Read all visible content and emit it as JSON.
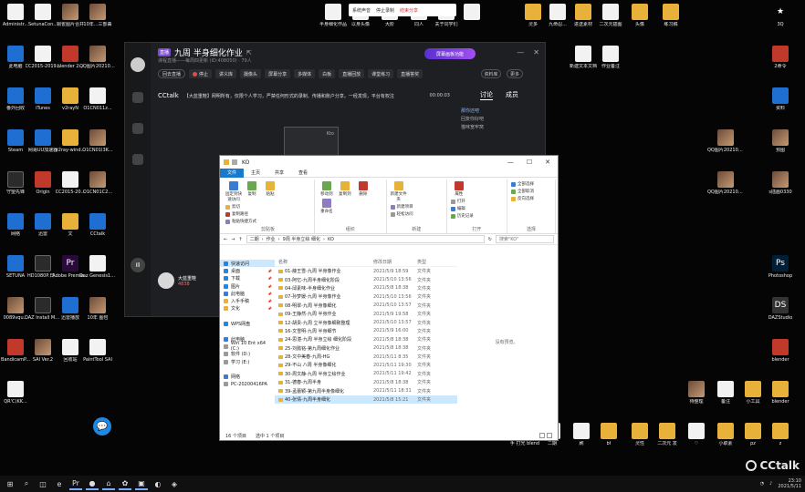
{
  "desktop": {
    "icons_left": [
      {
        "label": "Administr...",
        "kind": "file"
      },
      {
        "label": "SetunaCon...",
        "kind": "file"
      },
      {
        "label": "铜雀图片合并",
        "kind": "img"
      },
      {
        "label": "10年...三部曲",
        "kind": "img"
      },
      {
        "label": "此电脑",
        "kind": "blue"
      },
      {
        "label": "CC2015-2019...",
        "kind": "file"
      },
      {
        "label": "blender 2...",
        "kind": "red"
      },
      {
        "label": "QQ图片20210511...",
        "kind": "img"
      },
      {
        "label": "番外回收",
        "kind": "blue"
      },
      {
        "label": "iTunes",
        "kind": "blue"
      },
      {
        "label": "v2rayN",
        "kind": "folder"
      },
      {
        "label": "O1CN011z...",
        "kind": "file"
      },
      {
        "label": "Steam",
        "kind": "blue"
      },
      {
        "label": "网易UU加速器",
        "kind": "blue"
      },
      {
        "label": "v2ray-wind...",
        "kind": "folder"
      },
      {
        "label": "O1CN01I3K...",
        "kind": "img"
      },
      {
        "label": "守望先锋",
        "kind": "dark"
      },
      {
        "label": "Origin",
        "kind": "red"
      },
      {
        "label": "CC2015-20...",
        "kind": "file"
      },
      {
        "label": "O1CN01C2...",
        "kind": "img"
      },
      {
        "label": "网络",
        "kind": "blue"
      },
      {
        "label": "迅雷",
        "kind": "blue"
      },
      {
        "label": "文",
        "kind": "folder"
      },
      {
        "label": "CCtalk",
        "kind": "blue"
      },
      {
        "label": "SETUNA",
        "kind": "blue"
      },
      {
        "label": "HD1080P.日...",
        "kind": "dark"
      },
      {
        "label": "Adobe Premie...",
        "kind": "pr"
      },
      {
        "label": "Daz Genesis1.2...",
        "kind": "file"
      },
      {
        "label": "0089vqu...",
        "kind": "img"
      },
      {
        "label": "DAZ Install Manager...",
        "kind": "dark"
      },
      {
        "label": "迅雷播放",
        "kind": "blue"
      },
      {
        "label": "10年 图包",
        "kind": "img"
      },
      {
        "label": "BandicamP...",
        "kind": "red"
      },
      {
        "label": "SAI Ver.2",
        "kind": "img"
      },
      {
        "label": "回收站",
        "kind": "file"
      },
      {
        "label": "PaintTool SAI",
        "kind": "file"
      },
      {
        "label": "QR'C)KK...",
        "kind": "file"
      }
    ],
    "icons_top": [
      {
        "label": "半身细化作品",
        "kind": "file"
      },
      {
        "label": "以身头像",
        "kind": "file"
      },
      {
        "label": "大阶",
        "kind": "file"
      },
      {
        "label": "同人",
        "kind": "file"
      },
      {
        "label": "关于同学们",
        "kind": "file"
      },
      {
        "label": "",
        "kind": "file"
      },
      {
        "label": "灵多",
        "kind": "folder"
      },
      {
        "label": "九命忍...",
        "kind": "file"
      },
      {
        "label": "进送素材",
        "kind": "folder"
      },
      {
        "label": "二次元插图",
        "kind": "file"
      },
      {
        "label": "头像",
        "kind": "folder"
      },
      {
        "label": "练习稿",
        "kind": "folder"
      }
    ],
    "icons_right": [
      {
        "label": "3Q",
        "kind": "star"
      },
      {
        "label": "2命令",
        "kind": "red"
      },
      {
        "label": "资料",
        "kind": "blue"
      },
      {
        "label": "QQ图片20210414...",
        "kind": "img"
      },
      {
        "label": "预图",
        "kind": "img"
      },
      {
        "label": "QQ图片20210414...",
        "kind": "img"
      },
      {
        "label": "s插画0330",
        "kind": "img"
      },
      {
        "label": "Photoshop",
        "kind": "ps"
      },
      {
        "label": "DAZStudio",
        "kind": "ds"
      },
      {
        "label": "blender",
        "kind": "red"
      },
      {
        "label": "新建文本文档",
        "kind": "file"
      },
      {
        "label": "作业备注",
        "kind": "file"
      }
    ],
    "icons_bottom": [
      {
        "label": "待整理",
        "kind": "img"
      },
      {
        "label": "备注",
        "kind": "file"
      },
      {
        "label": "小工具",
        "kind": "folder"
      },
      {
        "label": "blender",
        "kind": "folder"
      },
      {
        "label": "手 打光 blend",
        "kind": "file"
      },
      {
        "label": "二期",
        "kind": "file"
      },
      {
        "label": "刷",
        "kind": "file"
      },
      {
        "label": "bf",
        "kind": "folder"
      },
      {
        "label": "灵性",
        "kind": "folder"
      },
      {
        "label": "二次元 发",
        "kind": "folder"
      },
      {
        "label": "♡",
        "kind": "file"
      },
      {
        "label": "小职素",
        "kind": "folder"
      },
      {
        "label": "pz",
        "kind": "folder"
      },
      {
        "label": "z",
        "kind": "folder"
      }
    ]
  },
  "recording_bar": {
    "mute": "系统声音",
    "stop": "停止录制",
    "share": "结束分享"
  },
  "cctalk": {
    "tag": "直播",
    "title": "九周 半身细化作业",
    "subtitle": "课程直播——每周四更新 (ID:408050) · 79人",
    "promo": "屏幕画板功能",
    "btn_more": "资料库",
    "btn_more2": "更多",
    "tools": [
      "回去直播",
      "停止",
      "讲义库",
      "摄像头",
      "屏幕分享",
      "多媒体",
      "白板",
      "直播回放",
      "课堂练习",
      "直播答奖"
    ],
    "ticker_logo": "CCtalk",
    "ticker_text": "【大蓝重鞋】网明所有，仅限个人学习，严禁任何形式的录制、传播和账户分享。一经发现，平台有权注",
    "timer": "00:00:03",
    "whiteboard_label": "Kto",
    "right_tabs": [
      "讨论",
      "成员"
    ],
    "messages": [
      {
        "user": "那你还吧",
        "text": ""
      },
      {
        "user": "",
        "text": "回复你好吧"
      },
      {
        "user": "",
        "text": "猫咪宽牢窝"
      }
    ],
    "teacher_name": "大蓝重鞋",
    "teacher_meta": "4838",
    "side_btn": "Ill"
  },
  "explorer": {
    "title": "KO",
    "ribbon_tabs": [
      "文件",
      "主页",
      "共享",
      "查看"
    ],
    "groups": [
      {
        "name": "剪贴板",
        "large": [
          "固定到快速访问",
          "复制",
          "粘贴"
        ],
        "small": [
          "剪切",
          "复制路径",
          "粘贴快捷方式"
        ]
      },
      {
        "name": "组织",
        "large": [
          "移动到",
          "复制到",
          "删除",
          "重命名"
        ],
        "small": []
      },
      {
        "name": "新建",
        "large": [
          "新建文件夹"
        ],
        "small": [
          "新建项目",
          "轻松访问"
        ]
      },
      {
        "name": "打开",
        "large": [
          "属性"
        ],
        "small": [
          "打开",
          "编辑",
          "历史记录"
        ]
      },
      {
        "name": "选择",
        "large": [],
        "small": [
          "全部选择",
          "全部取消",
          "反向选择"
        ]
      }
    ],
    "path": [
      "二期",
      "作业",
      "9周 半身立绘 细化",
      "KO"
    ],
    "search_placeholder": "搜索\"KO\"",
    "nav": [
      {
        "label": "快速访问",
        "sel": true,
        "pin": false,
        "color": "#1e88e5"
      },
      {
        "label": "桌面",
        "sel": false,
        "pin": true,
        "color": "#1e88e5"
      },
      {
        "label": "下载",
        "sel": false,
        "pin": true,
        "color": "#1e88e5"
      },
      {
        "label": "图片",
        "sel": false,
        "pin": true,
        "color": "#1e88e5"
      },
      {
        "label": "此电脑",
        "sel": false,
        "pin": true,
        "color": "#3a7bd5"
      },
      {
        "label": "入手手稿",
        "sel": false,
        "pin": true,
        "color": "#e8b23a"
      },
      {
        "label": "文化",
        "sel": false,
        "pin": true,
        "color": "#e8b23a"
      },
      {
        "label": "",
        "sel": false,
        "pin": false,
        "color": "#fff"
      },
      {
        "label": "WPS网盘",
        "sel": false,
        "pin": false,
        "color": "#1e88e5"
      },
      {
        "label": "",
        "sel": false,
        "pin": false,
        "color": "#fff"
      },
      {
        "label": "此电脑",
        "sel": false,
        "pin": false,
        "color": "#3a7bd5"
      },
      {
        "label": "Win 10 Ent x64 (C:)",
        "sel": false,
        "pin": false,
        "color": "#999"
      },
      {
        "label": "软件 (D:)",
        "sel": false,
        "pin": false,
        "color": "#999"
      },
      {
        "label": "学习 (E:)",
        "sel": false,
        "pin": false,
        "color": "#999"
      },
      {
        "label": "",
        "sel": false,
        "pin": false,
        "color": "#fff"
      },
      {
        "label": "网络",
        "sel": false,
        "pin": false,
        "color": "#3a7bd5"
      },
      {
        "label": "PC-20200416PA",
        "sel": false,
        "pin": false,
        "color": "#999"
      }
    ],
    "columns": [
      "名称",
      "修改日期",
      "类型"
    ],
    "files": [
      {
        "name": "01-薛王雪-九周 半身像作业",
        "date": "2021/5/9 18:59",
        "type": "文件夹",
        "sel": false
      },
      {
        "name": "03-阿忆-九周半身细化阶段",
        "date": "2021/5/10 13:56",
        "type": "文件夹",
        "sel": false
      },
      {
        "name": "04-邱素味-半身细化作业",
        "date": "2021/5/8 18:38",
        "type": "文件夹",
        "sel": false
      },
      {
        "name": "07-孙梦媛-九周 半身像作业",
        "date": "2021/5/10 13:56",
        "type": "文件夹",
        "sel": false
      },
      {
        "name": "08-明翠-九周 半身像细化",
        "date": "2021/5/10 13:57",
        "type": "文件夹",
        "sel": false
      },
      {
        "name": "09-王静然-九周 半身作业",
        "date": "2021/5/9 19:58",
        "type": "文件夹",
        "sel": false
      },
      {
        "name": "12-胡贵-九周 立半身像细致整理",
        "date": "2021/5/10 13:57",
        "type": "文件夹",
        "sel": false
      },
      {
        "name": "16-文雪明-九周 半身细节",
        "date": "2021/5/9 16:00",
        "type": "文件夹",
        "sel": false
      },
      {
        "name": "24-思湛-九周 半身立绘 细化阶段",
        "date": "2021/5/8 18:38",
        "type": "文件夹",
        "sel": false
      },
      {
        "name": "25-刘懿铭-第九周细化作业",
        "date": "2021/5/8 18:38",
        "type": "文件夹",
        "sel": false
      },
      {
        "name": "28-文中美春-九周-HG",
        "date": "2021/5/11 8:35",
        "type": "文件夹",
        "sel": false
      },
      {
        "name": "29-不山 八周 半身像细化",
        "date": "2021/5/11 19:30",
        "type": "文件夹",
        "sel": false
      },
      {
        "name": "30-周文静-九周 半身立绘作业",
        "date": "2021/5/11 19:42",
        "type": "文件夹",
        "sel": false
      },
      {
        "name": "31-德春-九周半身",
        "date": "2021/5/8 18:38",
        "type": "文件夹",
        "sel": false
      },
      {
        "name": "39-孟蕾颖-第九周半身像细化",
        "date": "2021/5/11 18:31",
        "type": "文件夹",
        "sel": false
      },
      {
        "name": "40-张倩-九周半身细化",
        "date": "2021/5/8 15:21",
        "type": "文件夹",
        "sel": true
      }
    ],
    "preview_text": "没有预览。",
    "status_count": "16 个项目",
    "status_selected": "选中 1 个项目"
  },
  "taskbar": {
    "items": [
      "⊞",
      "⌕",
      "◫",
      "e",
      "Pr",
      "●",
      "⌂",
      "✿",
      "▣",
      "◐",
      "◈"
    ],
    "clock_time": "23:10",
    "clock_date": "2021/5/11"
  },
  "watermark": "CCtalk"
}
